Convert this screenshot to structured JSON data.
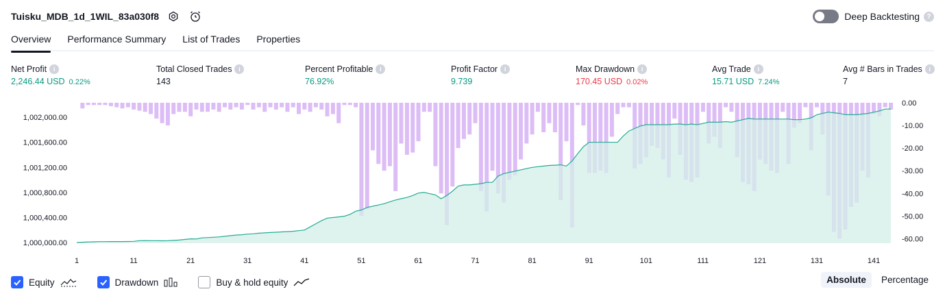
{
  "header": {
    "strategy_name": "Tuisku_MDB_1d_1WIL_83a030f8",
    "deep_backtesting_label": "Deep Backtesting"
  },
  "tabs": [
    {
      "label": "Overview",
      "active": true
    },
    {
      "label": "Performance Summary",
      "active": false
    },
    {
      "label": "List of Trades",
      "active": false
    },
    {
      "label": "Properties",
      "active": false
    }
  ],
  "metrics": [
    {
      "label": "Net Profit",
      "value": "2,246.44 USD",
      "pct": "0.22%",
      "tone": "pos"
    },
    {
      "label": "Total Closed Trades",
      "value": "143",
      "pct": "",
      "tone": "neu"
    },
    {
      "label": "Percent Profitable",
      "value": "76.92%",
      "pct": "",
      "tone": "pos"
    },
    {
      "label": "Profit Factor",
      "value": "9.739",
      "pct": "",
      "tone": "pos"
    },
    {
      "label": "Max Drawdown",
      "value": "170.45 USD",
      "pct": "0.02%",
      "tone": "neg"
    },
    {
      "label": "Avg Trade",
      "value": "15.71 USD",
      "pct": "7.24%",
      "tone": "pos"
    },
    {
      "label": "Avg # Bars in Trades",
      "value": "7",
      "pct": "",
      "tone": "neu"
    }
  ],
  "footer": {
    "equity_label": "Equity",
    "equity_checked": true,
    "drawdown_label": "Drawdown",
    "drawdown_checked": true,
    "buyhold_label": "Buy & hold equity",
    "buyhold_checked": false,
    "absolute_label": "Absolute",
    "percentage_label": "Percentage",
    "mode": "Absolute"
  },
  "colors": {
    "equity_line": "#22ab94",
    "equity_fill": "#d4efe8",
    "drawdown_bar": "#d8b6f5",
    "accent": "#2962ff"
  },
  "chart_data": {
    "type": "area",
    "x_ticks": [
      "1",
      "11",
      "21",
      "31",
      "41",
      "51",
      "61",
      "71",
      "81",
      "91",
      "101",
      "111",
      "121",
      "131",
      "141"
    ],
    "y_left_ticks": [
      "1,002,000.00",
      "1,001,600.00",
      "1,001,200.00",
      "1,000,800.00",
      "1,000,400.00",
      "1,000,000.00"
    ],
    "y_right_ticks": [
      "0.00",
      "-10.00",
      "-20.00",
      "-30.00",
      "-40.00",
      "-50.00",
      "-60.00"
    ],
    "y_left_range": [
      999990,
      1002230
    ],
    "y_right_range": [
      -62,
      0
    ],
    "trades": [
      1,
      2,
      3,
      4,
      5,
      6,
      7,
      8,
      9,
      10,
      11,
      12,
      13,
      14,
      15,
      16,
      17,
      18,
      19,
      20,
      21,
      22,
      23,
      24,
      25,
      26,
      27,
      28,
      29,
      30,
      31,
      32,
      33,
      34,
      35,
      36,
      37,
      38,
      39,
      40,
      41,
      42,
      43,
      44,
      45,
      46,
      47,
      48,
      49,
      50,
      51,
      52,
      53,
      54,
      55,
      56,
      57,
      58,
      59,
      60,
      61,
      62,
      63,
      64,
      65,
      66,
      67,
      68,
      69,
      70,
      71,
      72,
      73,
      74,
      75,
      76,
      77,
      78,
      79,
      80,
      81,
      82,
      83,
      84,
      85,
      86,
      87,
      88,
      89,
      90,
      91,
      92,
      93,
      94,
      95,
      96,
      97,
      98,
      99,
      100,
      101,
      102,
      103,
      104,
      105,
      106,
      107,
      108,
      109,
      110,
      111,
      112,
      113,
      114,
      115,
      116,
      117,
      118,
      119,
      120,
      121,
      122,
      123,
      124,
      125,
      126,
      127,
      128,
      129,
      130,
      131,
      132,
      133,
      134,
      135,
      136,
      137,
      138,
      139,
      140,
      141,
      142,
      143,
      144
    ],
    "series": [
      {
        "name": "Equity",
        "values": [
          1000000,
          1000005,
          1000010,
          1000012,
          1000015,
          1000015,
          1000016,
          1000016,
          1000016,
          1000017,
          1000020,
          1000030,
          1000032,
          1000030,
          1000030,
          1000028,
          1000030,
          1000035,
          1000040,
          1000050,
          1000060,
          1000058,
          1000075,
          1000080,
          1000085,
          1000090,
          1000100,
          1000110,
          1000120,
          1000125,
          1000135,
          1000140,
          1000150,
          1000155,
          1000160,
          1000165,
          1000170,
          1000175,
          1000180,
          1000190,
          1000200,
          1000250,
          1000300,
          1000350,
          1000390,
          1000400,
          1000410,
          1000420,
          1000450,
          1000500,
          1000520,
          1000560,
          1000580,
          1000600,
          1000620,
          1000650,
          1000680,
          1000700,
          1000720,
          1000750,
          1000790,
          1000800,
          1000780,
          1000760,
          1000700,
          1000750,
          1000820,
          1000900,
          1000920,
          1000920,
          1000930,
          1000940,
          1000960,
          1000960,
          1001060,
          1001100,
          1001120,
          1001140,
          1001160,
          1001180,
          1001200,
          1001210,
          1001220,
          1001230,
          1001235,
          1001240,
          1001220,
          1001300,
          1001420,
          1001530,
          1001600,
          1001600,
          1001600,
          1001600,
          1001600,
          1001600,
          1001700,
          1001780,
          1001820,
          1001860,
          1001880,
          1001880,
          1001880,
          1001880,
          1001880,
          1001890,
          1001890,
          1001880,
          1001890,
          1001880,
          1001900,
          1001920,
          1001920,
          1001920,
          1001930,
          1001920,
          1001940,
          1001960,
          1001980,
          1001970,
          1001970,
          1001970,
          1001970,
          1001970,
          1001970,
          1001970,
          1001960,
          1001960,
          1001970,
          1001990,
          1002040,
          1002060,
          1002080,
          1002070,
          1002060,
          1002040,
          1002040,
          1002040,
          1002050,
          1002060,
          1002080,
          1002100,
          1002130,
          1002130
        ]
      },
      {
        "name": "Drawdown",
        "values": [
          0,
          -2.5,
          -1,
          -1,
          -1,
          -1,
          -1.5,
          -2,
          -2.5,
          -2,
          -3,
          -3.5,
          -4,
          -5,
          -7,
          -9,
          -10,
          -5,
          -4,
          -4,
          -6,
          -3,
          -4,
          -4,
          -3,
          -4,
          -2,
          -3,
          -2,
          -3,
          -1,
          -3,
          -2,
          -4,
          -2,
          -3,
          -2,
          -4,
          -2,
          -5,
          -3,
          -4,
          -2,
          -3,
          -6,
          -5,
          -9,
          -1,
          -1,
          -2,
          -50,
          -47,
          -21,
          -27,
          -30,
          -28,
          -39,
          -18,
          -23,
          -22,
          -17,
          -4,
          -4,
          -28,
          -40,
          -54,
          -37,
          -20,
          -16,
          -14,
          -9,
          -39,
          -48,
          -30,
          -40,
          -44,
          -34,
          -32,
          -25,
          -18,
          -14,
          -4,
          -13,
          -9,
          -13,
          -43,
          -17,
          -55,
          -1,
          -10,
          -31,
          -31,
          -30,
          -31,
          -15,
          -5,
          -2,
          -2,
          -29,
          -27,
          -24,
          -19,
          -20,
          -25,
          -33,
          -7,
          -23,
          -34,
          -35,
          -33,
          -4,
          -18,
          -15,
          -20,
          -2,
          -4,
          -24,
          -35,
          -36,
          -39,
          -25,
          -27,
          -30,
          -31,
          -4,
          -27,
          -11,
          -9,
          -2,
          -21,
          -2,
          -14,
          -41,
          -57,
          -60,
          -56,
          -46,
          -44,
          -30,
          -33,
          -5,
          -6,
          -2,
          -3
        ]
      }
    ]
  }
}
